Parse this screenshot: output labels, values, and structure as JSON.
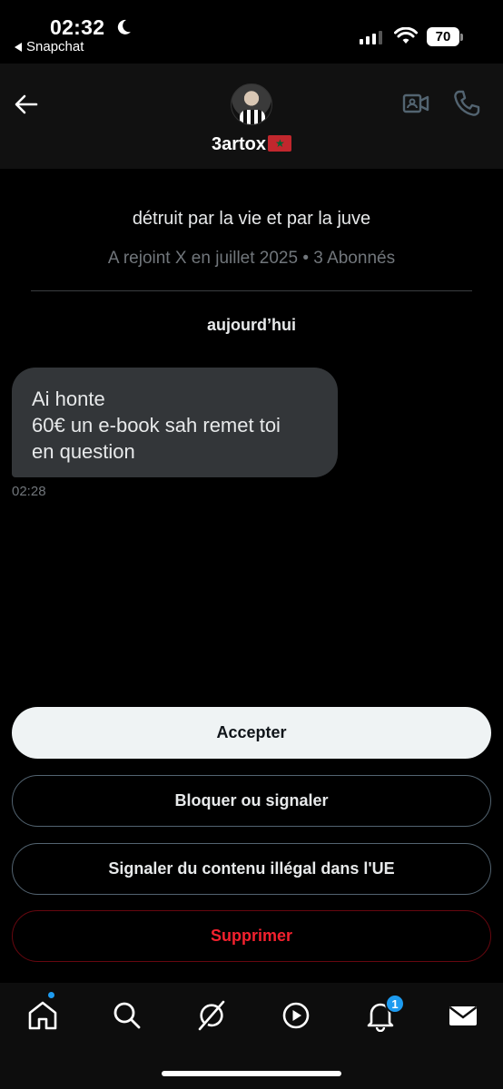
{
  "status_bar": {
    "time": "02:32",
    "back_app": "Snapchat",
    "battery": "70"
  },
  "header": {
    "username": "3artox",
    "flag": "★"
  },
  "profile": {
    "bio": "détruit par la vie et par la juve",
    "joined": "A rejoint X en juillet 2025 • 3 Abonnés"
  },
  "conversation": {
    "date_label": "aujourd’hui",
    "message": {
      "text": "Ai honte\n60€ un e-book sah remet toi\nen question",
      "time": "02:28"
    }
  },
  "actions": {
    "accept": "Accepter",
    "block": "Bloquer ou signaler",
    "report_eu": "Signaler du contenu illégal dans l'UE",
    "delete": "Supprimer"
  },
  "bottom_nav": {
    "notifications_count": "1"
  },
  "colors": {
    "accent": "#1d9bf0",
    "danger": "#f4212e",
    "bubble": "#333639"
  }
}
